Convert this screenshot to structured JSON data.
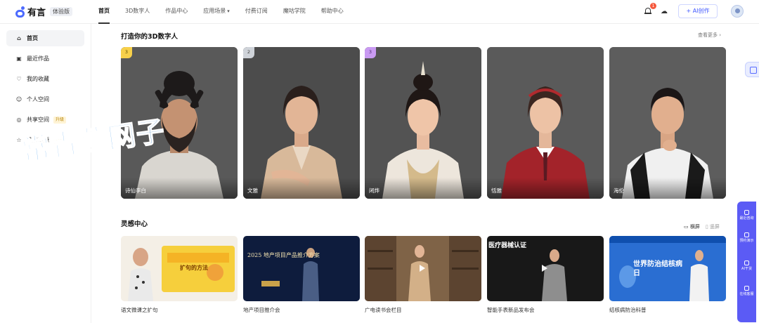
{
  "logo": {
    "name": "有言",
    "badge": "体验版"
  },
  "nav": [
    {
      "label": "首页",
      "active": true
    },
    {
      "label": "3D数字人"
    },
    {
      "label": "作品中心"
    },
    {
      "label": "应用场景",
      "dropdown": true
    },
    {
      "label": "付费订阅"
    },
    {
      "label": "魔咕学院"
    },
    {
      "label": "帮助中心"
    }
  ],
  "header": {
    "notification_count": "1",
    "ai_button": "+ AI创作",
    "icons": [
      "bell-icon",
      "cloud-download-icon",
      "avatar"
    ]
  },
  "sidebar": {
    "items": [
      {
        "label": "首页",
        "icon": "home-icon",
        "active": true
      },
      {
        "label": "最近作品",
        "icon": "recent-icon"
      },
      {
        "label": "我的收藏",
        "icon": "heart-icon"
      },
      {
        "label": "个人空间",
        "icon": "person-icon"
      },
      {
        "label": "共享空间",
        "icon": "shared-icon",
        "tag": "升级"
      },
      {
        "label": "品牌资源",
        "icon": "brand-icon",
        "tag": "升级"
      }
    ]
  },
  "digital_humans": {
    "title": "打造你的3D数字人",
    "more": "查看更多 ›",
    "cards": [
      {
        "name": "诗仙李白",
        "rank": "3"
      },
      {
        "name": "文雅",
        "rank": "2"
      },
      {
        "name": "闭烨",
        "rank": "3"
      },
      {
        "name": "恬雅",
        "rank": ""
      },
      {
        "name": "海伦",
        "rank": ""
      }
    ]
  },
  "inspiration": {
    "title": "灵感中心",
    "view_landscape": "横屏",
    "view_portrait": "竖屏",
    "videos": [
      {
        "caption": "语文微课之扩句",
        "overlay": "扩句的方法",
        "colors": [
          "#f6f1e8",
          "#f4d24a"
        ]
      },
      {
        "caption": "地产项目推介会",
        "overlay": "2025 地产项目产品推介方案",
        "colors": [
          "#0d1b3a",
          "#1b2d5c"
        ]
      },
      {
        "caption": "广电读书会栏目",
        "overlay": "",
        "colors": [
          "#8a6a48",
          "#5a4330"
        ]
      },
      {
        "caption": "智能手表新品发布会",
        "overlay": "医疗器械认证",
        "colors": [
          "#1a1a1a",
          "#2e2e2e"
        ]
      },
      {
        "caption": "结核病防治科普",
        "overlay": "世界防治结核病日",
        "colors": [
          "#0f4fae",
          "#2a6ed2"
        ]
      }
    ]
  },
  "right_panel": [
    "最近咨询",
    "预约演示",
    "AI干货",
    "在线客服"
  ],
  "watermark": "常青藤网子"
}
